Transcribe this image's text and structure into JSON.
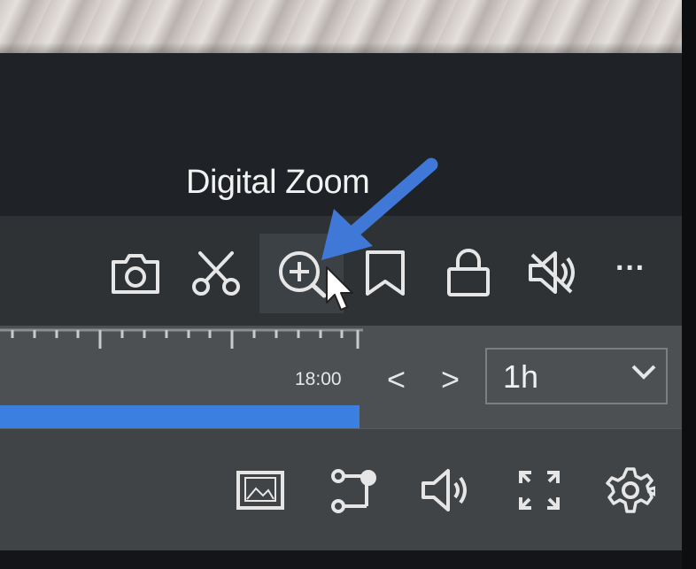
{
  "tooltip": {
    "text": "Digital Zoom"
  },
  "toolbar": {
    "icons": [
      "camera-icon",
      "scissors-icon",
      "zoom-in-icon",
      "bookmark-icon",
      "lock-icon",
      "mute-icon",
      "more-icon"
    ],
    "more_label": "···"
  },
  "timeline": {
    "time_label": "18:00",
    "progress": 1.0
  },
  "navigation": {
    "prev_label": "<",
    "next_label": ">"
  },
  "range_select": {
    "value": "1h"
  },
  "bottom_bar": {
    "icons": [
      "image-icon",
      "path-icon",
      "volume-icon",
      "fullscreen-icon",
      "settings-icon"
    ]
  },
  "colors": {
    "accent": "#3b7fe0",
    "annotation_arrow": "#3f78d6",
    "panel_dark": "#1f2226",
    "toolbar": "#2e3235",
    "timeline": "#4c5053"
  }
}
